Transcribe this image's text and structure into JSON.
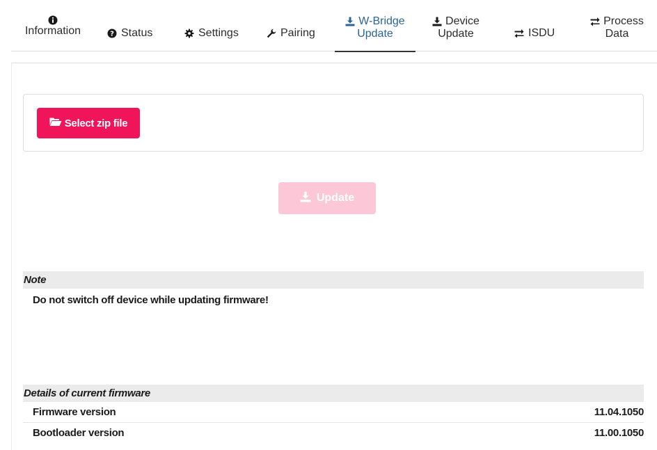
{
  "tabs": {
    "information": "Information",
    "status": "Status",
    "settings": "Settings",
    "pairing": "Pairing",
    "wbridge_line1": "W-Bridge",
    "wbridge_line2": "Update",
    "device_line1": "Device",
    "device_line2": "Update",
    "isdu": "ISDU",
    "process_line1": "Process",
    "process_line2": "Data",
    "active_color": "#2b6496"
  },
  "upload": {
    "select_label": "Select zip file",
    "update_label": "Update",
    "accent": "#f0145a",
    "update_enabled": false
  },
  "note": {
    "heading": "Note",
    "text": "Do not switch off device while updating firmware!"
  },
  "firmware": {
    "heading": "Details of current firmware",
    "rows": [
      {
        "label": "Firmware version",
        "value": "11.04.1050"
      },
      {
        "label": "Bootloader version",
        "value": "11.00.1050"
      }
    ]
  },
  "icons": {
    "information": "info-circle-icon",
    "status": "question-circle-icon",
    "settings": "gear-icon",
    "pairing": "wrench-icon",
    "wbridge": "download-icon",
    "device": "download-icon",
    "isdu": "exchange-arrows-icon",
    "process": "exchange-arrows-icon",
    "select": "folder-open-icon",
    "update": "download-icon"
  }
}
